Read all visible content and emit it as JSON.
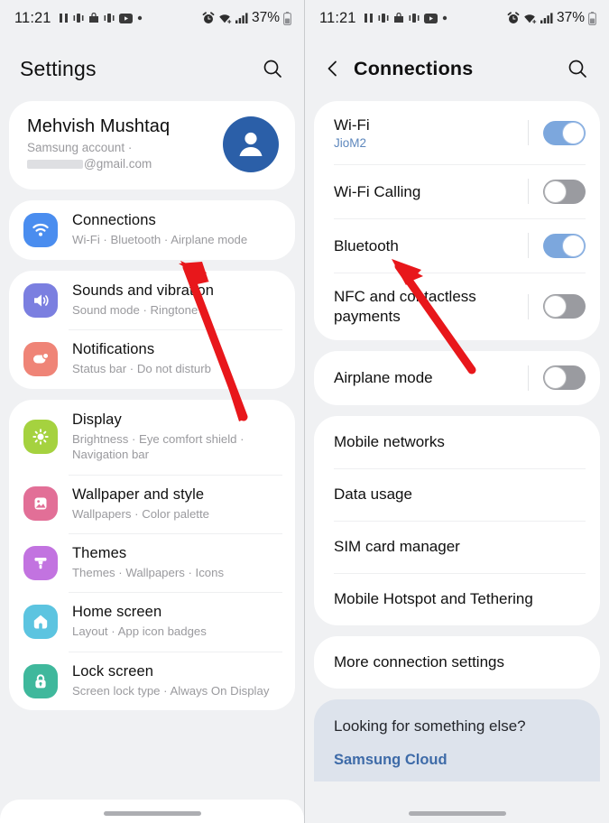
{
  "colors": {
    "page_bg": "#f0f1f3",
    "card_bg": "#ffffff",
    "accent_blue": "#5d87bd",
    "toggle_on": "#7ca7dd",
    "toggle_off": "#9a9ba0",
    "arrow_red": "#e8171b",
    "hint_bg": "#dde3ec",
    "link_blue": "#3e6ba8"
  },
  "status_bar": {
    "time": "11:21",
    "battery": "37%",
    "left_icons": [
      "pause-icon",
      "vibrate-icon",
      "bag-icon",
      "vibrate-icon",
      "youtube-icon",
      "dot-icon"
    ],
    "right_icons": [
      "alarm-icon",
      "wifi-icon",
      "signal-icon",
      "battery-icon"
    ]
  },
  "left_pane": {
    "header": {
      "title": "Settings",
      "search_icon": "search-icon"
    },
    "profile": {
      "name": "Mehvish Mushtaq",
      "account_label": "Samsung account",
      "separator": "·",
      "email_suffix": "@gmail.com",
      "email_redacted": true,
      "avatar_icon": "person-icon"
    },
    "groups": [
      {
        "items": [
          {
            "title": "Connections",
            "subtitle": "Wi-Fi · Bluetooth · Airplane mode",
            "icon": "wifi-icon",
            "icon_color": "#4a8def"
          }
        ]
      },
      {
        "items": [
          {
            "title": "Sounds and vibration",
            "subtitle": "Sound mode · Ringtone",
            "icon": "speaker-icon",
            "icon_color": "#7b7fe0"
          },
          {
            "title": "Notifications",
            "subtitle": "Status bar · Do not disturb",
            "icon": "notification-icon",
            "icon_color": "#ef8477"
          }
        ]
      },
      {
        "items": [
          {
            "title": "Display",
            "subtitle": "Brightness · Eye comfort shield · Navigation bar",
            "icon": "brightness-icon",
            "icon_color": "#a5d23f"
          },
          {
            "title": "Wallpaper and style",
            "subtitle": "Wallpapers · Color palette",
            "icon": "image-icon",
            "icon_color": "#e26f97"
          },
          {
            "title": "Themes",
            "subtitle": "Themes · Wallpapers · Icons",
            "icon": "brush-icon",
            "icon_color": "#c273e0"
          },
          {
            "title": "Home screen",
            "subtitle": "Layout · App icon badges",
            "icon": "home-icon",
            "icon_color": "#5cc4e0"
          },
          {
            "title": "Lock screen",
            "subtitle": "Screen lock type · Always On Display",
            "icon": "lock-icon",
            "icon_color": "#3fb89c"
          }
        ]
      }
    ]
  },
  "right_pane": {
    "header": {
      "title": "Connections",
      "back_icon": "chevron-left-icon",
      "search_icon": "search-icon"
    },
    "toggle_group": [
      {
        "title": "Wi-Fi",
        "subtitle": "JioM2",
        "state": "on"
      },
      {
        "title": "Wi-Fi Calling",
        "subtitle": "",
        "state": "off"
      },
      {
        "title": "Bluetooth",
        "subtitle": "",
        "state": "on"
      },
      {
        "title": "NFC and contactless payments",
        "subtitle": "",
        "state": "off"
      }
    ],
    "airplane_group": [
      {
        "title": "Airplane mode",
        "subtitle": "",
        "state": "off"
      }
    ],
    "list_group": [
      {
        "title": "Mobile networks"
      },
      {
        "title": "Data usage"
      },
      {
        "title": "SIM card manager"
      },
      {
        "title": "Mobile Hotspot and Tethering"
      }
    ],
    "more_group": [
      {
        "title": "More connection settings"
      }
    ],
    "hint": {
      "title": "Looking for something else?",
      "link": "Samsung Cloud"
    }
  },
  "annotations": [
    {
      "name": "arrow-to-connections",
      "pane": "left"
    },
    {
      "name": "arrow-to-bluetooth",
      "pane": "right"
    }
  ]
}
